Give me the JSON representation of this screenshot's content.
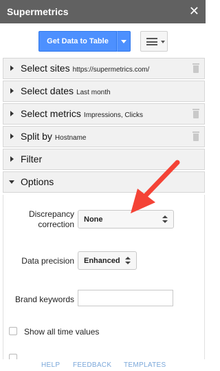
{
  "app": {
    "title": "Supermetrics",
    "close": "✕"
  },
  "toolbar": {
    "get_data_label": "Get Data to Table"
  },
  "sections": [
    {
      "label": "Select sites",
      "sub": "https://supermetrics.com/"
    },
    {
      "label": "Select dates",
      "sub": "Last month"
    },
    {
      "label": "Select metrics",
      "sub": "Impressions, Clicks"
    },
    {
      "label": "Split by",
      "sub": "Hostname"
    },
    {
      "label": "Filter",
      "sub": ""
    },
    {
      "label": "Options",
      "sub": ""
    }
  ],
  "options": {
    "discrepancy": {
      "label_line1": "Discrepancy",
      "label_line2": "correction",
      "value": "None"
    },
    "precision": {
      "label": "Data precision",
      "value": "Enhanced"
    },
    "brand_keywords": {
      "label": "Brand keywords",
      "value": ""
    },
    "show_all_time": {
      "label": "Show all time values"
    }
  },
  "footer": {
    "help": "HELP",
    "feedback": "FEEDBACK",
    "templates": "TEMPLATES"
  },
  "colors": {
    "titlebar": "#616161",
    "primary_button": "#4d90fe",
    "annotation_arrow": "#f44336",
    "footer_link": "#7aa7d9"
  }
}
